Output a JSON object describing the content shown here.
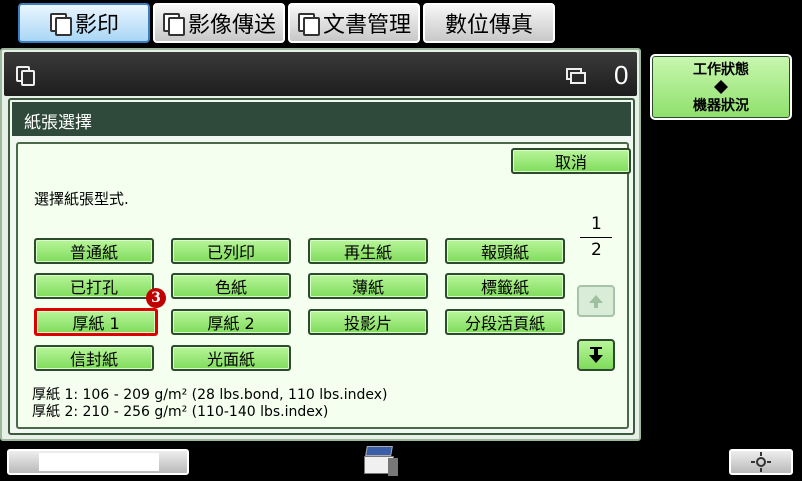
{
  "tabs": [
    {
      "label": "影印",
      "icon": "copy-icon",
      "active": true
    },
    {
      "label": "影像傳送",
      "icon": "image-send-icon",
      "active": false
    },
    {
      "label": "文書管理",
      "icon": "document-icon",
      "active": false
    },
    {
      "label": "數位傳真",
      "icon": "",
      "active": false
    }
  ],
  "status": {
    "count": "0"
  },
  "dialog": {
    "title": "紙張選擇",
    "cancel_label": "取消",
    "instruction": "選擇紙張型式.",
    "paper_types": [
      "普通紙",
      "已列印",
      "再生紙",
      "報頭紙",
      "已打孔",
      "色紙",
      "薄紙",
      "標籤紙",
      "厚紙 1",
      "厚紙 2",
      "投影片",
      "分段活頁紙",
      "信封紙",
      "光面紙"
    ],
    "selected_index": 8,
    "page": {
      "current": "1",
      "total": "2"
    },
    "step_marker": "3",
    "notes": [
      "厚紙 1: 106 - 209 g/m² (28 lbs.bond, 110 lbs.index)",
      "厚紙 2: 210 - 256 g/m² (110-140 lbs.index)"
    ]
  },
  "side": {
    "job_status_label": "工作狀態",
    "machine_status_label": "機器狀況"
  },
  "colors": {
    "accent_green": "#8fe06c",
    "title_bar": "#2f4a3a",
    "selected_border": "#dd0000"
  }
}
